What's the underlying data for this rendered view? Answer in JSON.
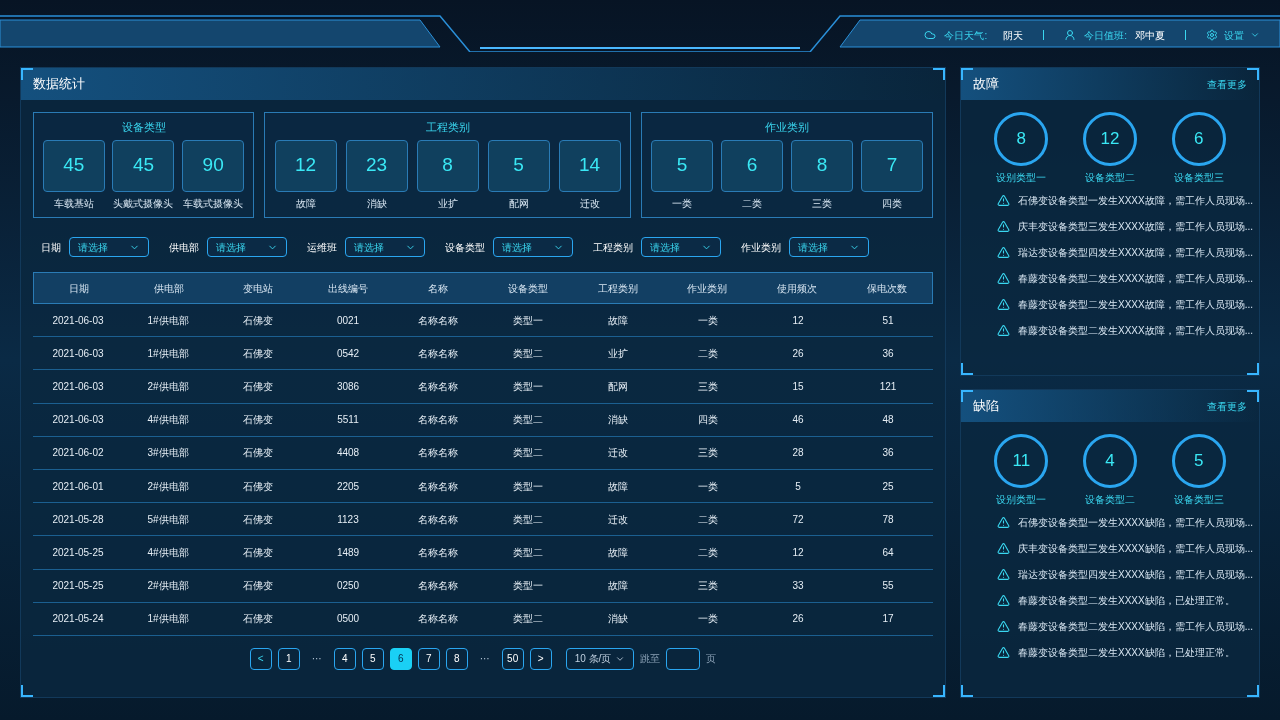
{
  "header": {
    "weather_label": "今日天气:",
    "weather": "阴天",
    "duty_label": "今日值班:",
    "duty": "邓中夏",
    "settings": "设置"
  },
  "stats": {
    "title": "数据统计",
    "groups": [
      {
        "title": "设备类型",
        "items": [
          {
            "value": "45",
            "label": "车载基站"
          },
          {
            "value": "45",
            "label": "头戴式摄像头"
          },
          {
            "value": "90",
            "label": "车载式摄像头"
          }
        ]
      },
      {
        "title": "工程类别",
        "items": [
          {
            "value": "12",
            "label": "故障"
          },
          {
            "value": "23",
            "label": "消缺"
          },
          {
            "value": "8",
            "label": "业扩"
          },
          {
            "value": "5",
            "label": "配网"
          },
          {
            "value": "14",
            "label": "迁改"
          }
        ]
      },
      {
        "title": "作业类别",
        "items": [
          {
            "value": "5",
            "label": "一类"
          },
          {
            "value": "6",
            "label": "二类"
          },
          {
            "value": "8",
            "label": "三类"
          },
          {
            "value": "7",
            "label": "四类"
          }
        ]
      }
    ]
  },
  "filters": [
    {
      "label": "日期",
      "placeholder": "请选择"
    },
    {
      "label": "供电部",
      "placeholder": "请选择"
    },
    {
      "label": "运维班",
      "placeholder": "请选择"
    },
    {
      "label": "设备类型",
      "placeholder": "请选择"
    },
    {
      "label": "工程类别",
      "placeholder": "请选择"
    },
    {
      "label": "作业类别",
      "placeholder": "请选择"
    }
  ],
  "table": {
    "columns": [
      "日期",
      "供电部",
      "变电站",
      "出线编号",
      "名称",
      "设备类型",
      "工程类别",
      "作业类别",
      "使用频次",
      "保电次数"
    ],
    "rows": [
      [
        "2021-06-03",
        "1#供电部",
        "石佛变",
        "0021",
        "名称名称",
        "类型一",
        "故障",
        "一类",
        "12",
        "51"
      ],
      [
        "2021-06-03",
        "1#供电部",
        "石佛变",
        "0542",
        "名称名称",
        "类型二",
        "业扩",
        "二类",
        "26",
        "36"
      ],
      [
        "2021-06-03",
        "2#供电部",
        "石佛变",
        "3086",
        "名称名称",
        "类型一",
        "配网",
        "三类",
        "15",
        "121"
      ],
      [
        "2021-06-03",
        "4#供电部",
        "石佛变",
        "5511",
        "名称名称",
        "类型二",
        "消缺",
        "四类",
        "46",
        "48"
      ],
      [
        "2021-06-02",
        "3#供电部",
        "石佛变",
        "4408",
        "名称名称",
        "类型二",
        "迁改",
        "三类",
        "28",
        "36"
      ],
      [
        "2021-06-01",
        "2#供电部",
        "石佛变",
        "2205",
        "名称名称",
        "类型一",
        "故障",
        "一类",
        "5",
        "25"
      ],
      [
        "2021-05-28",
        "5#供电部",
        "石佛变",
        "1123",
        "名称名称",
        "类型二",
        "迁改",
        "二类",
        "72",
        "78"
      ],
      [
        "2021-05-25",
        "4#供电部",
        "石佛变",
        "1489",
        "名称名称",
        "类型二",
        "故障",
        "二类",
        "12",
        "64"
      ],
      [
        "2021-05-25",
        "2#供电部",
        "石佛变",
        "0250",
        "名称名称",
        "类型一",
        "故障",
        "三类",
        "33",
        "55"
      ],
      [
        "2021-05-24",
        "1#供电部",
        "石佛变",
        "0500",
        "名称名称",
        "类型二",
        "消缺",
        "一类",
        "26",
        "17"
      ]
    ]
  },
  "pagination": {
    "prev": "<",
    "next": ">",
    "pages": [
      {
        "kind": "page",
        "label": "1",
        "selected": false
      },
      {
        "kind": "ellipsis",
        "label": "···"
      },
      {
        "kind": "page",
        "label": "4",
        "selected": false
      },
      {
        "kind": "page",
        "label": "5",
        "selected": false
      },
      {
        "kind": "page",
        "label": "6",
        "selected": true
      },
      {
        "kind": "page",
        "label": "7",
        "selected": false
      },
      {
        "kind": "page",
        "label": "8",
        "selected": false
      },
      {
        "kind": "ellipsis",
        "label": "···"
      },
      {
        "kind": "page",
        "label": "50",
        "selected": false
      }
    ],
    "page_size": "10 条/页",
    "jump_label": "跳至",
    "page_unit": "页"
  },
  "panels": [
    {
      "title": "故障",
      "more": "查看更多",
      "circles": [
        {
          "value": "8",
          "label": "设别类型一"
        },
        {
          "value": "12",
          "label": "设备类型二"
        },
        {
          "value": "6",
          "label": "设备类型三"
        }
      ],
      "alerts": [
        "石佛变设备类型一发生XXXX故障，需工作人员现场...",
        "庆丰变设备类型三发生XXXX故障，需工作人员现场...",
        "瑞达变设备类型四发生XXXX故障，需工作人员现场...",
        "春藤变设备类型二发生XXXX故障，需工作人员现场...",
        "春藤变设备类型二发生XXXX故障，需工作人员现场...",
        "春藤变设备类型二发生XXXX故障，需工作人员现场..."
      ]
    },
    {
      "title": "缺陷",
      "more": "查看更多",
      "circles": [
        {
          "value": "11",
          "label": "设别类型一"
        },
        {
          "value": "4",
          "label": "设备类型二"
        },
        {
          "value": "5",
          "label": "设备类型三"
        }
      ],
      "alerts": [
        "石佛变设备类型一发生XXXX缺陷，需工作人员现场...",
        "庆丰变设备类型三发生XXXX缺陷，需工作人员现场...",
        "瑞达变设备类型四发生XXXX缺陷，需工作人员现场...",
        "春藤变设备类型二发生XXXX缺陷，已处理正常。",
        "春藤变设备类型二发生XXXX缺陷，需工作人员现场...",
        "春藤变设备类型二发生XXXX缺陷，已处理正常。"
      ]
    }
  ]
}
